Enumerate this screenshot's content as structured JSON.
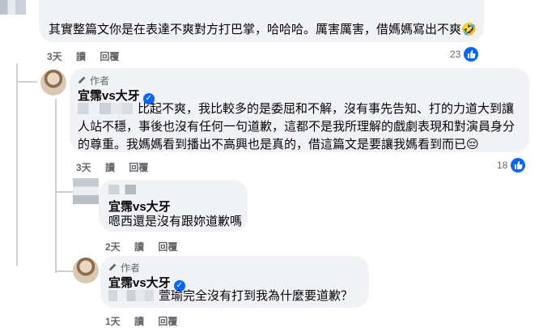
{
  "comments": [
    {
      "id": "c1",
      "text": "其實整篇文你是在表達不爽對方打巴掌，哈哈哈。厲害厲害，借媽媽寫出不爽🤣",
      "time": "3天",
      "read": "讀",
      "reply": "回覆",
      "likes": "23"
    },
    {
      "id": "c2",
      "author_label": "作者",
      "author": "宜霈vs大牙",
      "text": "比起不爽，我比較多的是委屈和不解，沒有事先告知、打的力道大到讓人站不穩，事後也沒有任何一句道歉，這都不是我所理解的戲劇表現和對演員身分的尊重。我媽媽看到播出不高興也是真的，借這篇文是要讓我媽看到而已😔",
      "time": "3天",
      "read": "讀",
      "reply": "回覆",
      "likes": "18"
    },
    {
      "id": "c3",
      "mention": "宜霈vs大牙",
      "text": "嗯西還是沒有跟妳道歉嗎",
      "time": "2天",
      "read": "讀",
      "reply": "回覆"
    },
    {
      "id": "c4",
      "author_label": "作者",
      "author": "宜霈vs大牙",
      "text": "萱瑜完全沒有打到我為什麼要道歉？",
      "time": "1天",
      "read": "讀",
      "reply": "回覆"
    }
  ],
  "colors": {
    "accent": "#0866ff",
    "bubble": "#f0f2f5",
    "meta": "#65676b"
  },
  "icons": {
    "verified": "verified-badge-icon",
    "like": "like-icon",
    "pen": "pencil-icon"
  }
}
